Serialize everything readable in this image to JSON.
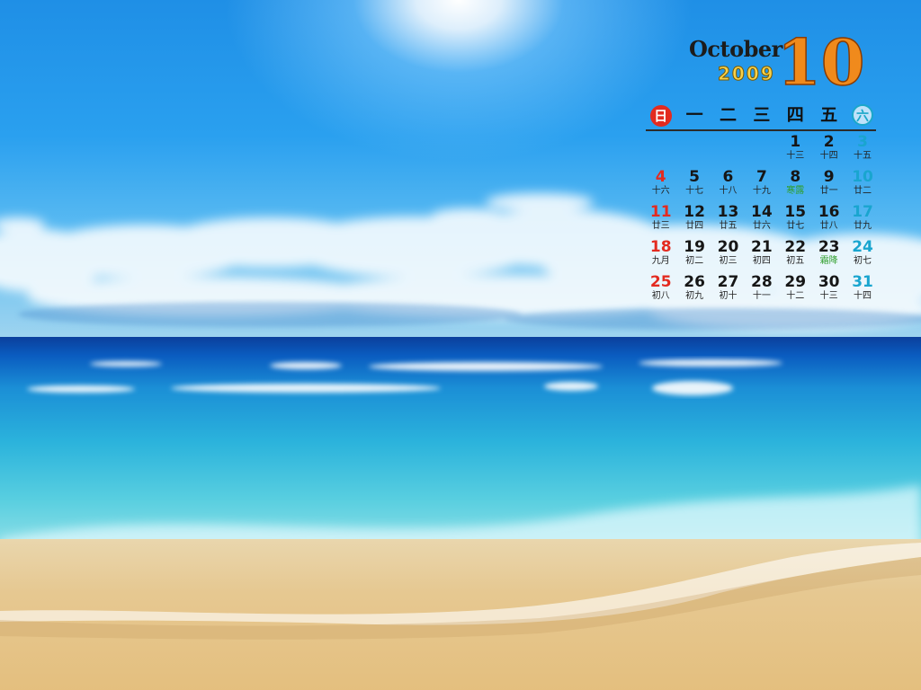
{
  "calendar": {
    "month_name": "October",
    "year": "2009",
    "month_number": "10",
    "weekdays": [
      "日",
      "一",
      "二",
      "三",
      "四",
      "五",
      "六"
    ],
    "weeks": [
      [
        null,
        null,
        null,
        null,
        {
          "day": "1",
          "lunar": "十三"
        },
        {
          "day": "2",
          "lunar": "十四"
        },
        {
          "day": "3",
          "lunar": "十五"
        }
      ],
      [
        {
          "day": "4",
          "lunar": "十六"
        },
        {
          "day": "5",
          "lunar": "十七"
        },
        {
          "day": "6",
          "lunar": "十八"
        },
        {
          "day": "7",
          "lunar": "十九"
        },
        {
          "day": "8",
          "lunar": "寒露",
          "term": true
        },
        {
          "day": "9",
          "lunar": "廿一"
        },
        {
          "day": "10",
          "lunar": "廿二"
        }
      ],
      [
        {
          "day": "11",
          "lunar": "廿三"
        },
        {
          "day": "12",
          "lunar": "廿四"
        },
        {
          "day": "13",
          "lunar": "廿五"
        },
        {
          "day": "14",
          "lunar": "廿六"
        },
        {
          "day": "15",
          "lunar": "廿七"
        },
        {
          "day": "16",
          "lunar": "廿八"
        },
        {
          "day": "17",
          "lunar": "廿九"
        }
      ],
      [
        {
          "day": "18",
          "lunar": "九月"
        },
        {
          "day": "19",
          "lunar": "初二"
        },
        {
          "day": "20",
          "lunar": "初三"
        },
        {
          "day": "21",
          "lunar": "初四"
        },
        {
          "day": "22",
          "lunar": "初五"
        },
        {
          "day": "23",
          "lunar": "霜降",
          "term": true
        },
        {
          "day": "24",
          "lunar": "初七"
        }
      ],
      [
        {
          "day": "25",
          "lunar": "初八"
        },
        {
          "day": "26",
          "lunar": "初九"
        },
        {
          "day": "27",
          "lunar": "初十"
        },
        {
          "day": "28",
          "lunar": "十一"
        },
        {
          "day": "29",
          "lunar": "十二"
        },
        {
          "day": "30",
          "lunar": "十三"
        },
        {
          "day": "31",
          "lunar": "十四"
        }
      ]
    ]
  },
  "colors": {
    "sunday": "#e32b20",
    "saturday": "#19a5cf",
    "solar_term": "#2f9e2a",
    "big_day": "#f08a1c"
  }
}
